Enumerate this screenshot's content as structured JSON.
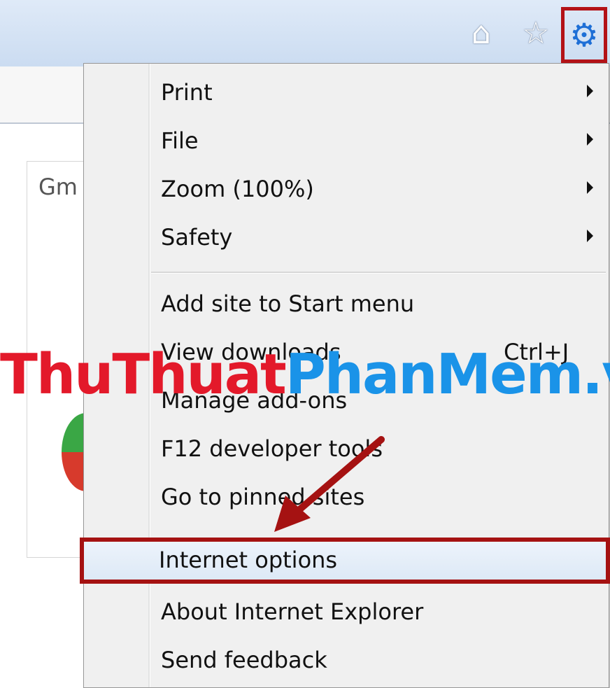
{
  "toolbar": {
    "icons": [
      "home-icon",
      "favorites-star-icon",
      "gear-icon"
    ],
    "gear_icon_highlight_color": "#b31217",
    "gear_icon_color": "#1e6fd6"
  },
  "page": {
    "partial_text": "Gm"
  },
  "menu": {
    "items": [
      {
        "label": "Print",
        "submenu": true
      },
      {
        "label": "File",
        "submenu": true
      },
      {
        "label": "Zoom (100%)",
        "submenu": true
      },
      {
        "label": "Safety",
        "submenu": true
      },
      {
        "label": "Add site to Start menu"
      },
      {
        "label": "View downloads",
        "shortcut": "Ctrl+J"
      },
      {
        "label": "Manage add-ons"
      },
      {
        "label": "F12 developer tools"
      },
      {
        "label": "Go to pinned sites"
      },
      {
        "label": "Internet options",
        "highlighted": true
      },
      {
        "label": "About Internet Explorer"
      },
      {
        "label": "Send feedback"
      }
    ]
  },
  "watermark": {
    "part1": "ThuThuat",
    "part2": "PhanMem.vn",
    "color1": "#e3192a",
    "color2": "#1a93e8"
  },
  "annotation_color": "#a51212"
}
